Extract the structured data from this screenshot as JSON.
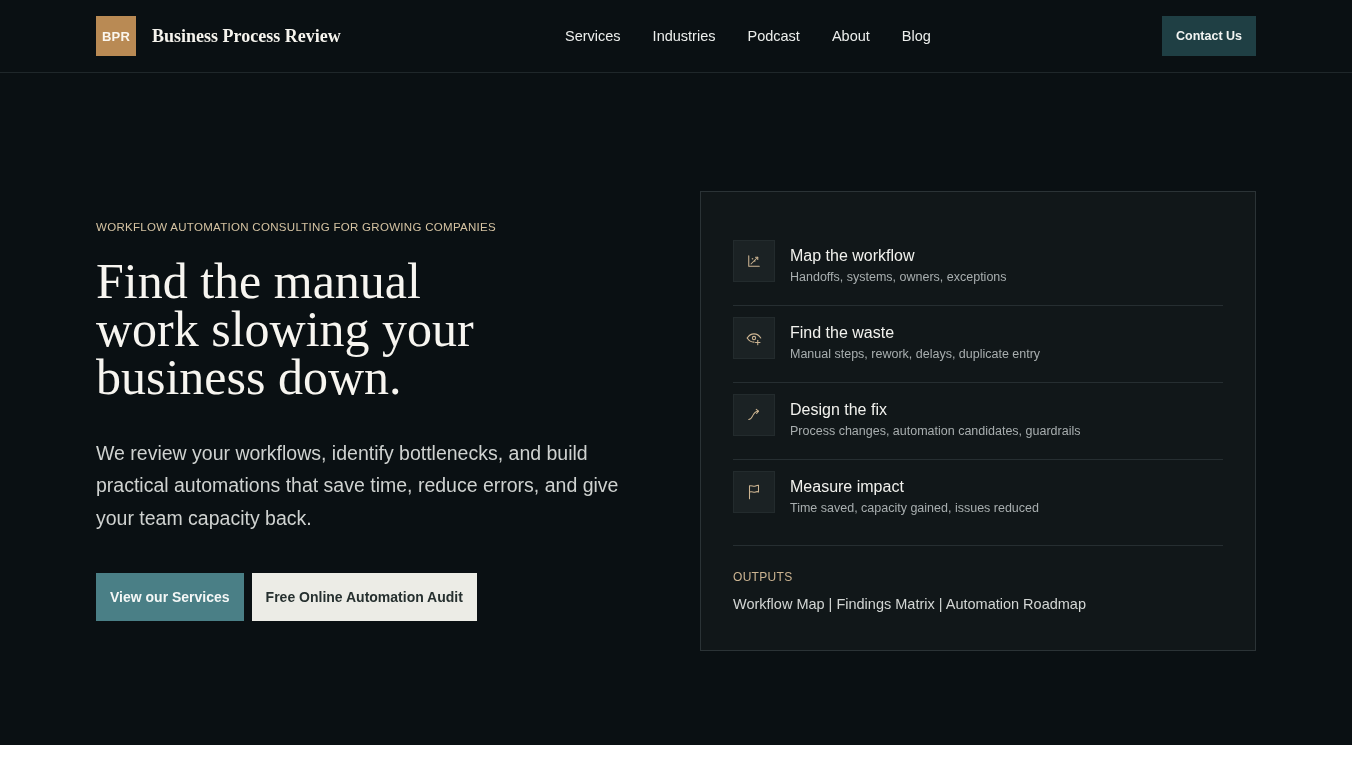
{
  "header": {
    "logo": {
      "mark": "BPR",
      "name": "Business Process Review"
    },
    "nav": [
      {
        "label": "Services"
      },
      {
        "label": "Industries"
      },
      {
        "label": "Podcast"
      },
      {
        "label": "About"
      },
      {
        "label": "Blog"
      }
    ],
    "cta": "Contact Us"
  },
  "hero": {
    "eyebrow": "WORKFLOW AUTOMATION CONSULTING FOR GROWING COMPANIES",
    "headline": "Find the manual work slowing your business down.",
    "description": "We review your workflows, identify bottlenecks, and build practical automations that save time, reduce errors, and give your team capacity back.",
    "buttons": [
      {
        "label": "View our Services",
        "kind": "primary"
      },
      {
        "label": "Free Online Automation Audit",
        "kind": "secondary"
      }
    ]
  },
  "process_card": {
    "steps": [
      {
        "title": "Map the workflow",
        "subtitle": "Handoffs, systems, owners, exceptions"
      },
      {
        "title": "Find the waste",
        "subtitle": "Manual steps, rework, delays, duplicate entry"
      },
      {
        "title": "Design the fix",
        "subtitle": "Process changes, automation candidates, guardrails"
      },
      {
        "title": "Measure impact",
        "subtitle": "Time saved, capacity gained, issues reduced"
      }
    ],
    "outputs": {
      "label": "OUTPUTS",
      "text": "Workflow Map | Findings Matrix | Automation Roadmap"
    }
  }
}
